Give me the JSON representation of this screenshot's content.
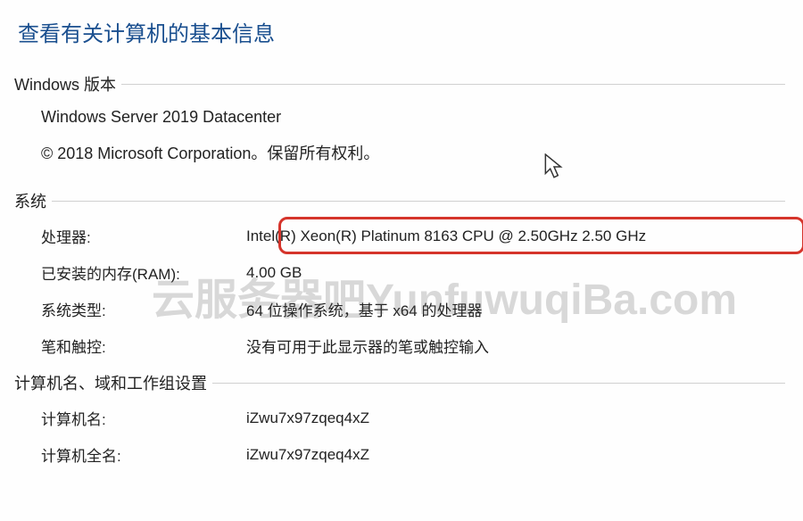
{
  "page_title": "查看有关计算机的基本信息",
  "windows_edition": {
    "heading": "Windows 版本",
    "name": "Windows Server 2019 Datacenter",
    "copyright": "© 2018 Microsoft Corporation。保留所有权利。"
  },
  "system": {
    "heading": "系统",
    "rows": {
      "processor": {
        "label": "处理器:",
        "value": "Intel(R) Xeon(R) Platinum 8163 CPU @ 2.50GHz   2.50 GHz"
      },
      "ram": {
        "label": "已安装的内存(RAM):",
        "value": "4.00 GB"
      },
      "system_type": {
        "label": "系统类型:",
        "value": "64 位操作系统，基于 x64 的处理器"
      },
      "pen_touch": {
        "label": "笔和触控:",
        "value": "没有可用于此显示器的笔或触控输入"
      }
    }
  },
  "computer_name": {
    "heading": "计算机名、域和工作组设置",
    "rows": {
      "name": {
        "label": "计算机名:",
        "value": "iZwu7x97zqeq4xZ"
      },
      "fullname": {
        "label": "计算机全名:",
        "value": "iZwu7x97zqeq4xZ"
      }
    }
  },
  "watermark": "云服务器吧YunfuwuqiBa.com"
}
